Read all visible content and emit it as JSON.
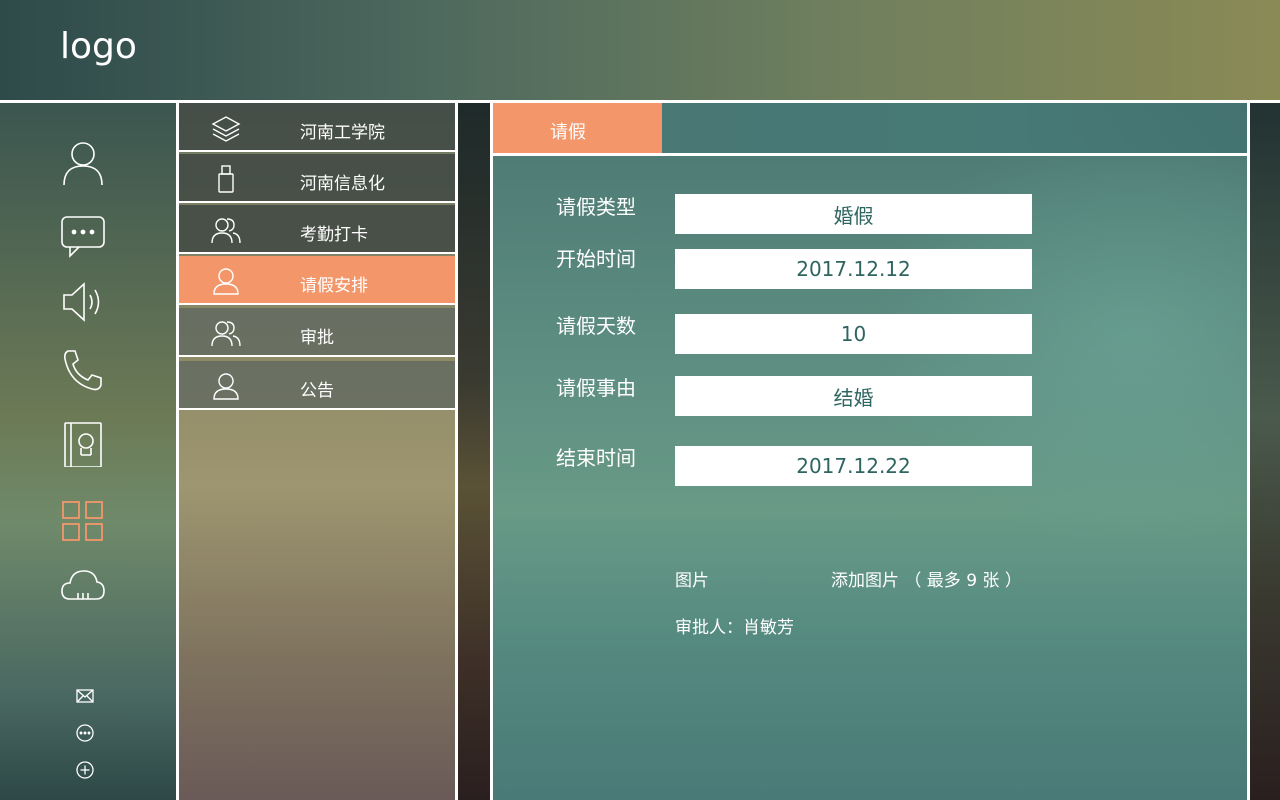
{
  "header": {
    "logo": "logo"
  },
  "sidebar": {
    "icons": [
      "user-icon",
      "chat-icon",
      "speaker-icon",
      "phone-icon",
      "contacts-icon",
      "apps-grid-icon",
      "cloud-icon"
    ],
    "bottom_icons": [
      "mail-icon",
      "more-icon",
      "add-icon"
    ],
    "active_color": "#f3976b"
  },
  "menu": {
    "items": [
      {
        "label": "河南工学院",
        "icon": "layers-icon"
      },
      {
        "label": "河南信息化",
        "icon": "usb-icon"
      },
      {
        "label": "考勤打卡",
        "icon": "group-icon"
      },
      {
        "label": "请假安排",
        "icon": "person-icon",
        "active": true
      },
      {
        "label": "审批",
        "icon": "group-icon"
      },
      {
        "label": "公告",
        "icon": "person-icon"
      }
    ]
  },
  "tab": {
    "label": "请假"
  },
  "form": {
    "leave_type_label": "请假类型",
    "leave_type_value": "婚假",
    "start_label": "开始时间",
    "start_value": "2017.12.12",
    "days_label": "请假天数",
    "days_value": "10",
    "reason_label": "请假事由",
    "reason_value": "结婚",
    "end_label": "结束时间",
    "end_value": "2017.12.22",
    "image_label": "图片",
    "add_image": "添加图片 （ 最多 9 张 ）",
    "approver": "审批人：肖敏芳"
  },
  "colors": {
    "accent": "#f3976b",
    "panel": "#5f8f82",
    "input_text": "#2f6560"
  }
}
